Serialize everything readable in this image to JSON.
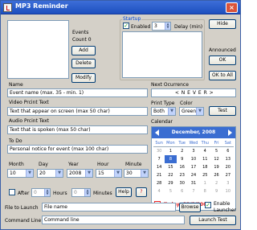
{
  "window": {
    "title": "MP3 Reminder",
    "close_glyph": "×"
  },
  "events": {
    "label": "Events",
    "count_label": "Count 0",
    "add": "Add",
    "delete": "Delete",
    "modify": "Modify"
  },
  "startup": {
    "label": "Startup",
    "enabled_label": "Enabled",
    "enabled_checked": true,
    "delay_value": "3",
    "delay_label": "Delay (min)"
  },
  "buttons": {
    "hide": "Hide",
    "ok": "OK",
    "ok_to_all": "OK to All",
    "test": "Test",
    "help": "Help",
    "question": "?",
    "browse": "Browse",
    "launch_test": "Launch Test"
  },
  "announced": {
    "label": "Announced"
  },
  "name": {
    "label": "Name",
    "value": "Event name (max. 35 - min. 1)"
  },
  "next_occurrence": {
    "label": "Next Ocurrence",
    "value": "< N E V E R >"
  },
  "video_print": {
    "label": "Video Prcint Text",
    "value": "Text that appear on screen (max 50 char)"
  },
  "print_type": {
    "label": "Print Type",
    "value": "Both"
  },
  "color": {
    "label": "Color",
    "value": "Green"
  },
  "audio_print": {
    "label": "Audio Prcint Text",
    "value": "Text that is spoken (max 50 char)"
  },
  "calendar": {
    "label": "Calendar",
    "month_title": "December, 2008",
    "dow": [
      "Sun",
      "Mon",
      "Tue",
      "Wed",
      "Thu",
      "Fri",
      "Sat"
    ],
    "weeks": [
      [
        "30",
        "1",
        "2",
        "3",
        "4",
        "5",
        "6"
      ],
      [
        "7",
        "8",
        "9",
        "10",
        "11",
        "12",
        "13"
      ],
      [
        "14",
        "15",
        "16",
        "17",
        "18",
        "19",
        "20"
      ],
      [
        "21",
        "22",
        "23",
        "24",
        "25",
        "26",
        "27"
      ],
      [
        "28",
        "29",
        "30",
        "31",
        "1",
        "2",
        "3"
      ],
      [
        "4",
        "5",
        "6",
        "7",
        "8",
        "9",
        "10"
      ]
    ],
    "today_label": "Today: 12/8/2008",
    "accent": "#3a6dd1",
    "today_color": "#e22222"
  },
  "todo": {
    "label": "To Do",
    "value": "Personal notice for event (max 100 char)"
  },
  "datetime": {
    "month": {
      "label": "Month",
      "value": "10"
    },
    "day": {
      "label": "Day",
      "value": "20"
    },
    "year": {
      "label": "Year",
      "value": "2008"
    },
    "hour": {
      "label": "Hour",
      "value": "15"
    },
    "minute": {
      "label": "Minute",
      "value": "30"
    }
  },
  "after": {
    "label": "After",
    "hours_value": "0",
    "hours_label": "Hours",
    "minutes_value": "0",
    "minutes_label": "Minutes"
  },
  "file_to_launch": {
    "label": "File to Launch",
    "value": "File name"
  },
  "enable_launcher": {
    "label_line1": "Enable",
    "label_line2": "Launcher"
  },
  "command_line": {
    "label": "Command Line",
    "value": "Command line"
  }
}
